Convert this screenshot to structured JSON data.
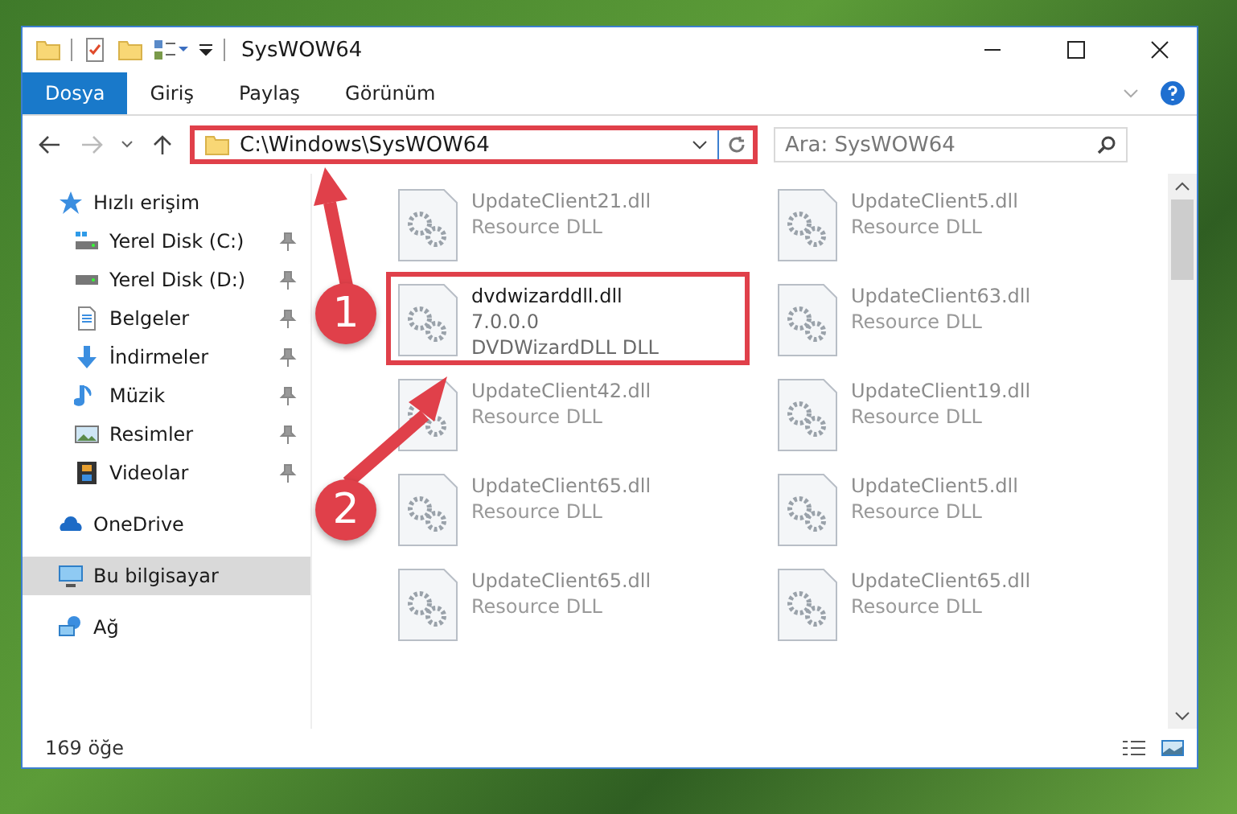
{
  "window": {
    "title": "SysWOW64"
  },
  "ribbon_tabs": [
    {
      "label": "Dosya",
      "selected": true
    },
    {
      "label": "Giriş",
      "selected": false
    },
    {
      "label": "Paylaş",
      "selected": false
    },
    {
      "label": "Görünüm",
      "selected": false
    }
  ],
  "address": {
    "value": "C:\\Windows\\SysWOW64",
    "annotated": true
  },
  "search": {
    "placeholder": "Ara: SysWOW64"
  },
  "sidebar": {
    "items": [
      {
        "label": "Hızlı erişim",
        "selected": false,
        "children": [
          {
            "label": "Yerel Disk (C:)",
            "pinned": true,
            "selected": false
          },
          {
            "label": "Yerel Disk (D:)",
            "pinned": true,
            "selected": false
          },
          {
            "label": "Belgeler",
            "pinned": true,
            "selected": false
          },
          {
            "label": "İndirmeler",
            "pinned": true,
            "selected": false
          },
          {
            "label": "Müzik",
            "pinned": true,
            "selected": false
          },
          {
            "label": "Resimler",
            "pinned": true,
            "selected": false
          },
          {
            "label": "Videolar",
            "pinned": true,
            "selected": false
          }
        ]
      },
      {
        "label": "OneDrive",
        "selected": false
      },
      {
        "label": "Bu bilgisayar",
        "selected": true
      },
      {
        "label": "Ağ",
        "selected": false
      }
    ]
  },
  "files": [
    {
      "name": "UpdateClient21.dll",
      "lines": [
        "Resource DLL"
      ],
      "faded": true,
      "annotated": false
    },
    {
      "name": "UpdateClient5.dll",
      "lines": [
        "Resource DLL"
      ],
      "faded": true,
      "annotated": false
    },
    {
      "name": "dvdwizarddll.dll",
      "lines": [
        "7.0.0.0",
        "DVDWizardDLL DLL"
      ],
      "faded": false,
      "annotated": true
    },
    {
      "name": "UpdateClient63.dll",
      "lines": [
        "Resource DLL"
      ],
      "faded": true,
      "annotated": false
    },
    {
      "name": "UpdateClient42.dll",
      "lines": [
        "Resource DLL"
      ],
      "faded": true,
      "annotated": false
    },
    {
      "name": "UpdateClient19.dll",
      "lines": [
        "Resource DLL"
      ],
      "faded": true,
      "annotated": false
    },
    {
      "name": "UpdateClient65.dll",
      "lines": [
        "Resource DLL"
      ],
      "faded": true,
      "annotated": false
    },
    {
      "name": "UpdateClient5.dll",
      "lines": [
        "Resource DLL"
      ],
      "faded": true,
      "annotated": false
    },
    {
      "name": "UpdateClient65.dll",
      "lines": [
        "Resource DLL"
      ],
      "faded": true,
      "annotated": false
    },
    {
      "name": "UpdateClient65.dll",
      "lines": [
        "Resource DLL"
      ],
      "faded": true,
      "annotated": false
    }
  ],
  "status_bar": {
    "count": "169 öğe"
  },
  "annotations": [
    {
      "label": "1"
    },
    {
      "label": "2"
    }
  ]
}
